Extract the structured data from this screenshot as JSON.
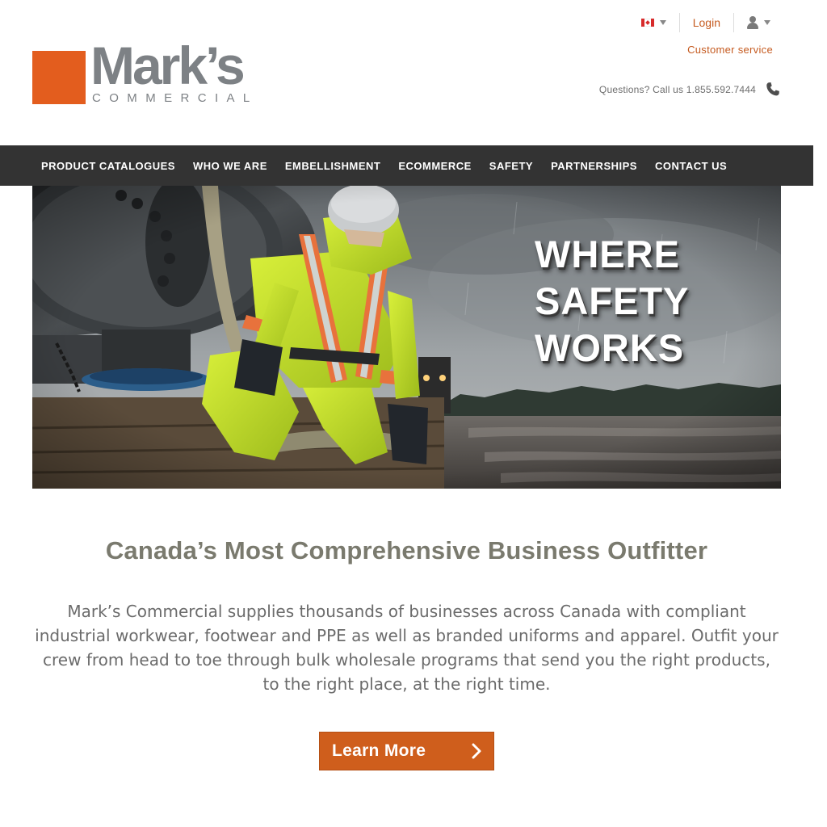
{
  "brand": {
    "name": "Mark’s",
    "sub": "COMMERCIAL",
    "accent": "#e35d1e",
    "gray": "#7d8185"
  },
  "utility": {
    "language_icon": "canada-flag-icon",
    "login_label": "Login",
    "account_icon": "user-icon",
    "customer_service_label": "Customer service",
    "phone_text": "Questions? Call us 1.855.592.7444",
    "phone_icon": "phone-icon"
  },
  "nav": {
    "items": [
      {
        "label": "PRODUCT CATALOGUES"
      },
      {
        "label": "WHO WE ARE"
      },
      {
        "label": "EMBELLISHMENT"
      },
      {
        "label": "ECOMMERCE"
      },
      {
        "label": "SAFETY"
      },
      {
        "label": "PARTNERSHIPS"
      },
      {
        "label": "CONTACT US"
      }
    ],
    "background": "#333333"
  },
  "hero": {
    "lines": [
      "WHERE",
      "SAFETY",
      "WORKS"
    ]
  },
  "intro": {
    "heading": "Canada’s Most Comprehensive Business Outfitter",
    "body": "Mark’s Commercial supplies thousands of businesses across Canada with compliant industrial workwear, footwear and PPE as well as branded uniforms and apparel. Outfit your crew from head to toe through bulk wholesale programs that send you the right products, to the right place, at the right time.",
    "cta_label": "Learn More",
    "cta_icon": "chevron-right-icon",
    "cta_color": "#cf5e1c"
  }
}
